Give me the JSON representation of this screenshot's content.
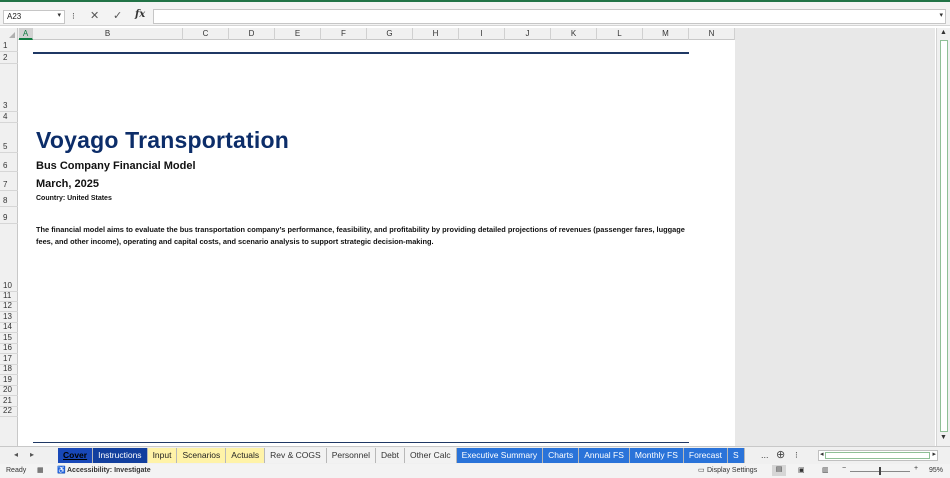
{
  "formula_bar": {
    "name_box": "A23",
    "dropdown_glyph": "▾",
    "options_glyph": "⁝",
    "cancel_glyph": "✕",
    "enter_glyph": "✓",
    "fx_label": "fx",
    "formula_value": ""
  },
  "columns": [
    "A",
    "B",
    "C",
    "D",
    "E",
    "F",
    "G",
    "H",
    "I",
    "J",
    "K",
    "L",
    "M",
    "N"
  ],
  "selected_column": "A",
  "rows": [
    "1",
    "2",
    "3",
    "4",
    "5",
    "6",
    "7",
    "8",
    "9",
    "10",
    "11",
    "12",
    "13",
    "14",
    "15",
    "16",
    "17",
    "18",
    "19",
    "20",
    "21",
    "22"
  ],
  "sheet": {
    "title": "Voyago Transportation",
    "subtitle": "Bus Company Financial Model",
    "date": "March, 2025",
    "country": "Country:  United States",
    "description": "The financial model aims to evaluate the bus transportation company’s performance, feasibility, and profitability by providing detailed projections of revenues (passenger fares, luggage fees, and other income), operating and capital costs, and scenario analysis to support strategic decision-making."
  },
  "tabs": [
    {
      "label": "Cover",
      "style": "active"
    },
    {
      "label": "Instructions",
      "style": "dark"
    },
    {
      "label": "Input",
      "style": "yellow"
    },
    {
      "label": "Scenarios",
      "style": "yellow"
    },
    {
      "label": "Actuals",
      "style": "yellow"
    },
    {
      "label": "Rev & COGS",
      "style": "plain"
    },
    {
      "label": "Personnel",
      "style": "plain"
    },
    {
      "label": "Debt",
      "style": "plain"
    },
    {
      "label": "Other Calc",
      "style": "plain"
    },
    {
      "label": "Executive Summary",
      "style": "blue"
    },
    {
      "label": "Charts",
      "style": "blue"
    },
    {
      "label": "Annual FS",
      "style": "blue"
    },
    {
      "label": "Monthly FS",
      "style": "blue"
    },
    {
      "label": "Forecast",
      "style": "blue"
    },
    {
      "label": "S",
      "style": "blue"
    }
  ],
  "tab_nav": {
    "prev": "◂",
    "next": "▸",
    "more": "...",
    "add": "⊕",
    "options": "⁝"
  },
  "status": {
    "ready": "Ready",
    "accessibility": "Accessibility: Investigate",
    "display_settings": "Display Settings",
    "zoom_minus": "−",
    "zoom_plus": "+",
    "zoom": "95%"
  },
  "colors": {
    "title": "#0c2d69",
    "accent_green": "#217346",
    "tab_blue": "#2a73d9",
    "tab_yellow": "#fff3a8"
  }
}
